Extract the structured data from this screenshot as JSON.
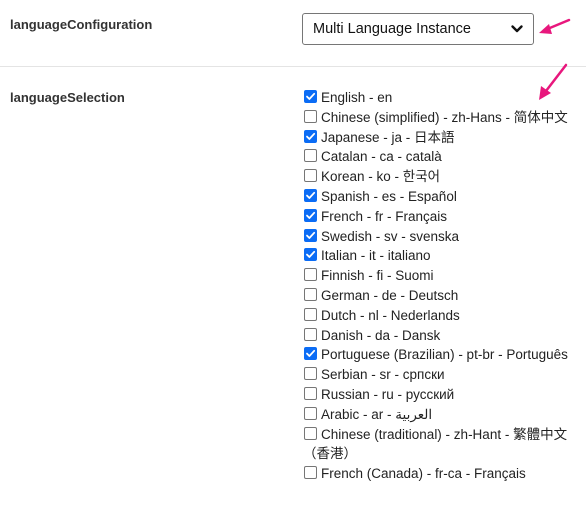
{
  "config": {
    "label": "languageConfiguration",
    "selected": "Multi Language Instance"
  },
  "selection": {
    "label": "languageSelection",
    "items": [
      {
        "label": "English - en",
        "checked": true
      },
      {
        "label": "Chinese (simplified) - zh-Hans - 简体中文",
        "checked": false
      },
      {
        "label": "Japanese - ja - 日本語",
        "checked": true
      },
      {
        "label": "Catalan - ca - català",
        "checked": false
      },
      {
        "label": "Korean - ko - 한국어",
        "checked": false
      },
      {
        "label": "Spanish - es - Español",
        "checked": true
      },
      {
        "label": "French - fr - Français",
        "checked": true
      },
      {
        "label": "Swedish - sv - svenska",
        "checked": true
      },
      {
        "label": "Italian - it - italiano",
        "checked": true
      },
      {
        "label": "Finnish - fi - Suomi",
        "checked": false
      },
      {
        "label": "German - de - Deutsch",
        "checked": false
      },
      {
        "label": "Dutch - nl - Nederlands",
        "checked": false
      },
      {
        "label": "Danish - da - Dansk",
        "checked": false
      },
      {
        "label": "Portuguese (Brazilian) - pt-br - Português",
        "checked": true
      },
      {
        "label": "Serbian - sr - српски",
        "checked": false
      },
      {
        "label": "Russian - ru - русский",
        "checked": false
      },
      {
        "label": "Arabic - ar - العربية",
        "checked": false
      },
      {
        "label": "Chinese (traditional) - zh-Hant - 繁體中文（香港）",
        "checked": false
      },
      {
        "label": "French (Canada) - fr-ca - Français",
        "checked": false
      }
    ]
  },
  "colors": {
    "checkbox_checked": "#0b6cf5",
    "annotation_arrow": "#e8177d"
  },
  "icons": {
    "select_chevron": "chevron-down-icon",
    "annotation": "arrow-icon",
    "checkmark": "checkmark-icon"
  }
}
